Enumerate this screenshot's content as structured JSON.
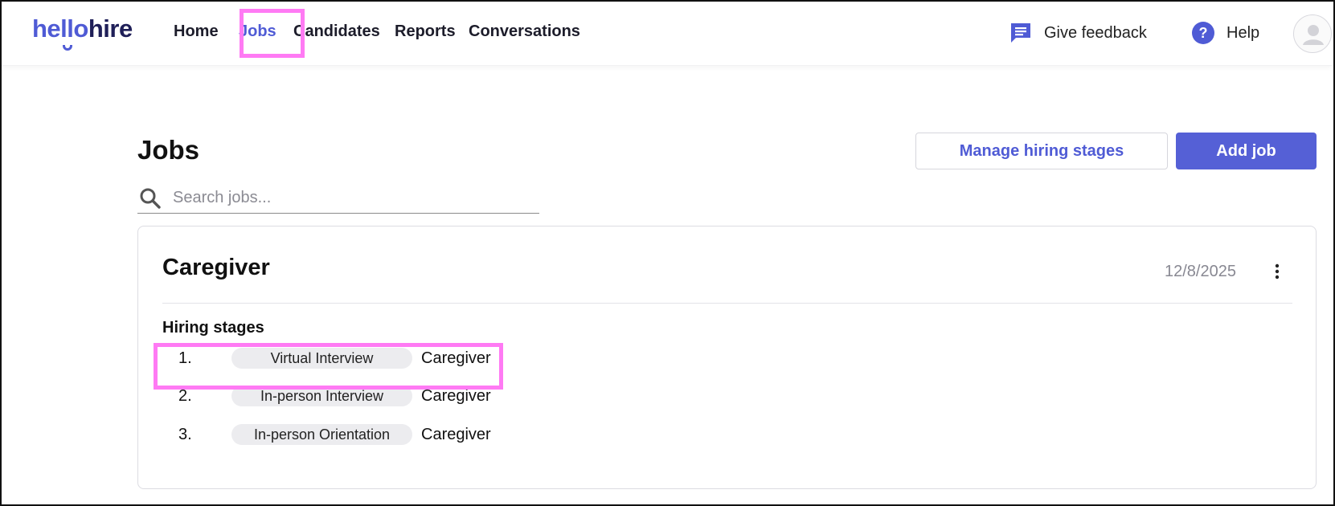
{
  "brand": {
    "logo_part1": "hello",
    "logo_part2": "hire",
    "accent": "#4f5bd5",
    "highlight": "#ff7af4"
  },
  "nav": {
    "items": [
      {
        "label": "Home"
      },
      {
        "label": "Jobs"
      },
      {
        "label": "Candidates"
      },
      {
        "label": "Reports"
      },
      {
        "label": "Conversations"
      }
    ],
    "active": "Jobs"
  },
  "header": {
    "feedback_label": "Give feedback",
    "feedback_icon": "chat-icon",
    "help_label": "Help",
    "help_icon": "question-circle-icon",
    "avatar_icon": "user-avatar-icon"
  },
  "main": {
    "title": "Jobs",
    "manage_button": "Manage hiring stages",
    "add_button": "Add job",
    "search": {
      "placeholder": "Search jobs...",
      "value": "",
      "icon": "search-icon"
    }
  },
  "job": {
    "title": "Caregiver",
    "date": "12/8/2025",
    "menu_icon": "kebab-icon",
    "stages_label": "Hiring stages",
    "stages": [
      {
        "num": "1.",
        "name": "Virtual Interview",
        "role": "Caregiver"
      },
      {
        "num": "2.",
        "name": "In-person Interview",
        "role": "Caregiver"
      },
      {
        "num": "3.",
        "name": "In-person Orientation",
        "role": "Caregiver"
      }
    ]
  }
}
